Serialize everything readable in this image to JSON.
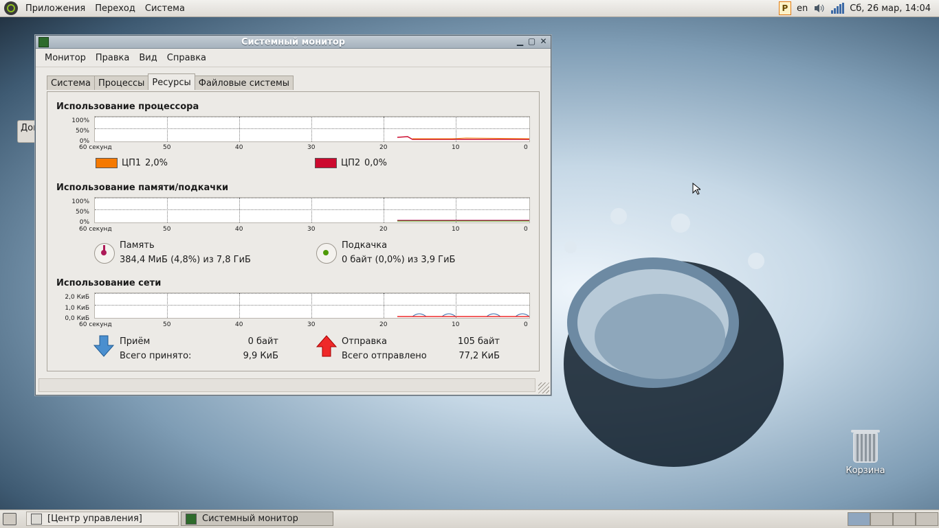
{
  "top_panel": {
    "menus": [
      "Приложения",
      "Переход",
      "Система"
    ],
    "layout": "en",
    "clock": "Сб, 26 мар, 14:04"
  },
  "desktop": {
    "partial_window_label": "Дом",
    "trash_label": "Корзина"
  },
  "window": {
    "title": "Системный монитор",
    "menu": [
      "Монитор",
      "Правка",
      "Вид",
      "Справка"
    ],
    "tabs": [
      "Система",
      "Процессы",
      "Ресурсы",
      "Файловые системы"
    ],
    "active_tab": "Ресурсы",
    "cpu": {
      "title": "Использование процессора",
      "y_ticks": [
        "100%",
        "50%",
        "0%"
      ],
      "cpu1_label": "ЦП1",
      "cpu1_value": "2,0%",
      "cpu1_color": "#f57900",
      "cpu2_label": "ЦП2",
      "cpu2_value": "0,0%",
      "cpu2_color": "#cc0a2e"
    },
    "memory": {
      "title": "Использование памяти/подкачки",
      "y_ticks": [
        "100%",
        "50%",
        "0%"
      ],
      "mem_label": "Память",
      "mem_value": "384,4 МиБ (4,8%) из 7,8 ГиБ",
      "mem_color": "#ad1a58",
      "swap_label": "Подкачка",
      "swap_value": "0 байт (0,0%) из 3,9 ГиБ",
      "swap_color": "#4e9a06"
    },
    "network": {
      "title": "Использование сети",
      "y_ticks": [
        "2,0 КиБ",
        "1,0 КиБ",
        "0,0 КиБ"
      ],
      "recv_label": "Приём",
      "recv_value": "0 байт",
      "recv_total_label": "Всего принято:",
      "recv_total_value": "9,9 КиБ",
      "recv_color": "#3465a4",
      "send_label": "Отправка",
      "send_value": "105 байт",
      "send_total_label": "Всего отправлено",
      "send_total_value": "77,2 КиБ",
      "send_color": "#ef2929"
    },
    "x_ticks": [
      "60 секунд",
      "50",
      "40",
      "30",
      "20",
      "10",
      "0"
    ]
  },
  "taskbar": {
    "tasks": [
      "[Центр управления]",
      "Системный монитор"
    ]
  }
}
